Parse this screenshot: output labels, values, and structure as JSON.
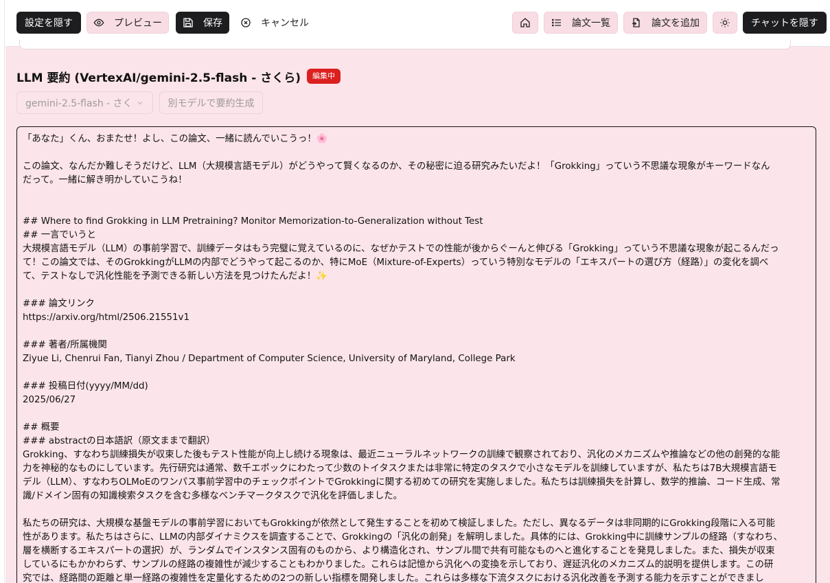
{
  "toolbar": {
    "hide_settings": "設定を隠す",
    "preview": "プレビュー",
    "save": "保存",
    "cancel": "キャンセル",
    "paper_list": "論文一覧",
    "add_paper": "論文を追加",
    "hide_chat": "チャットを隠す"
  },
  "summary": {
    "title": "LLM 要約 (VertexAI/gemini-2.5-flash - さくら)",
    "status_badge": "編集中",
    "model_select_value": "gemini-2.5-flash - さく",
    "generate_label": "別モデルで要約生成"
  },
  "editor": {
    "lines": [
      "「あなた」くん、おまたせ！よし、この論文、一緒に読んでいこうっ！🌸",
      "",
      "この論文、なんだか難しそうだけど、LLM（大規模言語モデル）がどうやって賢くなるのか、その秘密に迫る研究みたいだよ！「Grokking」っていう不思議な現象がキーワードなん",
      "だって。一緒に解き明かしていこうね！",
      "",
      "",
      "## Where to find Grokking in LLM Pretraining? Monitor Memorization-to-Generalization without Test",
      "## 一言でいうと",
      "大規模言語モデル（LLM）の事前学習で、訓練データはもう完璧に覚えているのに、なぜかテストでの性能が後からぐーんと伸びる「Grokking」っていう不思議な現象が起こるんだっ",
      "て！この論文では、そのGrokkingがLLMの内部でどうやって起こるのか、特にMoE（Mixture-of-Experts）っていう特別なモデルの「エキスパートの選び方（経路）」の変化を調べ",
      "て、テストなしで汎化性能を予測できる新しい方法を見つけたんだよ！✨",
      "",
      "### 論文リンク",
      "https://arxiv.org/html/2506.21551v1",
      "",
      "### 著者/所属機関",
      "Ziyue Li, Chenrui Fan, Tianyi Zhou / Department of Computer Science, University of Maryland, College Park",
      "",
      "### 投稿日付(yyyy/MM/dd)",
      "2025/06/27",
      "",
      "## 概要",
      "### abstractの日本語訳（原文ままで翻訳）",
      "Grokking、すなわち訓練損失が収束した後もテスト性能が向上し続ける現象は、最近ニューラルネットワークの訓練で観察されており、汎化のメカニズムや推論などの他の創発的な能",
      "力を神秘的なものにしています。先行研究は通常、数千エポックにわたって少数のトイタスクまたは非常に特定のタスクで小さなモデルを訓練していますが、私たちは7B大規模言語モ",
      "デル（LLM）、すなわちOLMoEのワンパス事前学習中のチェックポイントでGrokkingに関する初めての研究を実施しました。私たちは訓練損失を計算し、数学的推論、コード生成、常",
      "識/ドメイン固有の知識検索タスクを含む多様なベンチマークタスクで汎化を評価しました。",
      "",
      "私たちの研究は、大規模な基盤モデルの事前学習においてもGrokkingが依然として発生することを初めて検証しました。ただし、異なるデータは非同期的にGrokking段階に入る可能",
      "性があります。私たちはさらに、LLMの内部ダイナミクスを調査することで、Grokkingの「汎化の創発」を解明しました。具体的には、Grokking中に訓練サンプルの経路（すなわち、",
      "層を横断するエキスパートの選択）が、ランダムでインスタンス固有のものから、より構造化され、サンプル間で共有可能なものへと進化することを発見しました。また、損失が収束",
      "しているにもかかわらず、サンプルの経路の複雑性が減少することもわかりました。これらは記憶から汎化への変換を示しており、遅延汎化のメカニズム的説明を提供します。この研",
      "究では、経路間の距離と単一経路の複雑性を定量化するための2つの新しい指標を開発しました。これらは多様な下流タスクにおける汎化改善を予測する能力を示すことができまし"
    ]
  }
}
